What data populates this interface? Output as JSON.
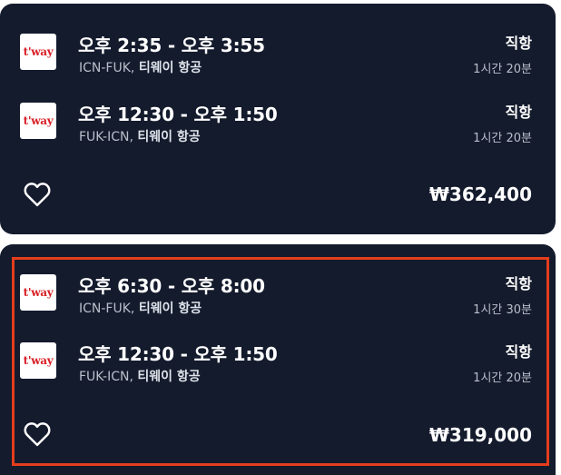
{
  "itineraries": [
    {
      "legs": [
        {
          "airline_logo": "t'way",
          "times": "오후 2:35 - 오후 3:55",
          "route": "ICN-FUK,",
          "airline": "티웨이 항공",
          "stops": "직항",
          "duration": "1시간 20분"
        },
        {
          "airline_logo": "t'way",
          "times": "오후 12:30 - 오후 1:50",
          "route": "FUK-ICN,",
          "airline": "티웨이 항공",
          "stops": "직항",
          "duration": "1시간 20분"
        }
      ],
      "price": "₩362,400",
      "favorite_icon": "heart-outline-icon"
    },
    {
      "legs": [
        {
          "airline_logo": "t'way",
          "times": "오후 6:30 - 오후 8:00",
          "route": "ICN-FUK,",
          "airline": "티웨이 항공",
          "stops": "직항",
          "duration": "1시간 30분"
        },
        {
          "airline_logo": "t'way",
          "times": "오후 12:30 - 오후 1:50",
          "route": "FUK-ICN,",
          "airline": "티웨이 항공",
          "stops": "직항",
          "duration": "1시간 20분"
        }
      ],
      "price": "₩319,000",
      "favorite_icon": "heart-outline-icon",
      "highlighted": true
    }
  ],
  "colors": {
    "card_background": "#141b2d",
    "highlight_border": "#e53d1c",
    "logo_red": "#d81f26"
  }
}
